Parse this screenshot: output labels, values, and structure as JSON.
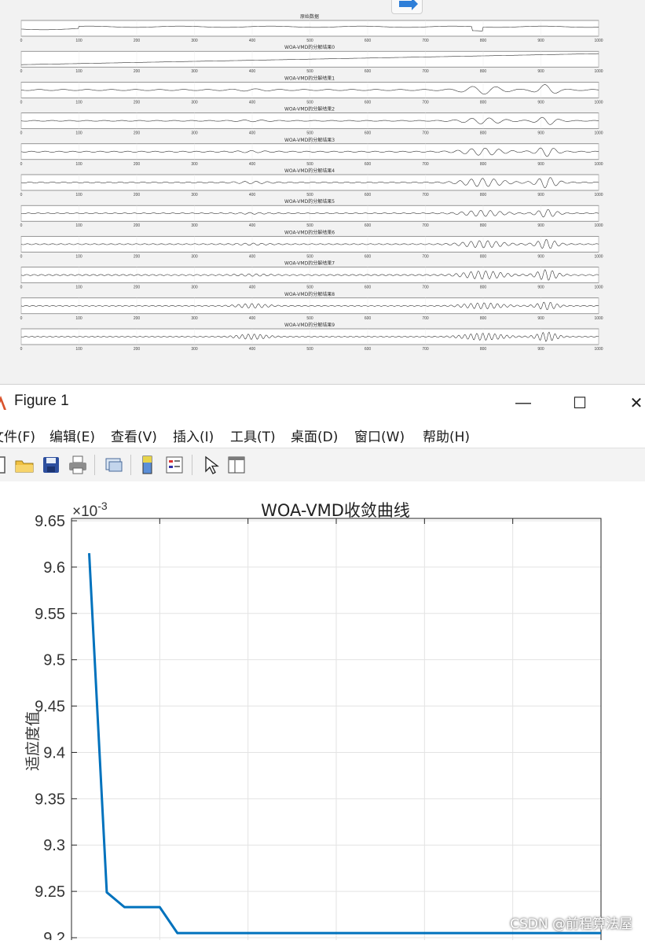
{
  "top_figure": {
    "panel_titles": [
      "原始数据",
      "WOA-VMD的分解结果0",
      "WOA-VMD的分解结果1",
      "WOA-VMD的分解结果2",
      "WOA-VMD的分解结果3",
      "WOA-VMD的分解结果4",
      "WOA-VMD的分解结果5",
      "WOA-VMD的分解结果6",
      "WOA-VMD的分解结果7",
      "WOA-VMD的分解结果8",
      "WOA-VMD的分解结果9"
    ],
    "x_ticks": [
      "0",
      "100",
      "200",
      "300",
      "400",
      "500",
      "600",
      "700",
      "800",
      "900",
      "1000"
    ],
    "xlim": [
      0,
      1000
    ]
  },
  "window": {
    "title": "Figure 1",
    "minimize_glyph": "—",
    "maximize_glyph": "☐",
    "close_glyph": "✕"
  },
  "menu": {
    "items": [
      "文件(F)",
      "编辑(E)",
      "查看(V)",
      "插入(I)",
      "工具(T)",
      "桌面(D)",
      "窗口(W)",
      "帮助(H)"
    ]
  },
  "toolbar": {
    "icons": [
      "new-figure-icon",
      "open-folder-icon",
      "save-icon",
      "print-icon",
      "link-plot-icon",
      "insert-colorbar-icon",
      "insert-legend-icon",
      "pointer-icon",
      "property-editor-icon"
    ]
  },
  "chart_data": {
    "type": "line",
    "title": "WOA-VMD收敛曲线",
    "ylabel": "适应度值",
    "xlabel": "",
    "exponent_label": "×10",
    "exponent_power": "-3",
    "y_tick_labels": [
      "9.2",
      "9.25",
      "9.3",
      "9.35",
      "9.4",
      "9.45",
      "9.5",
      "9.55",
      "9.6",
      "9.65"
    ],
    "y_ticks": [
      9.2,
      9.25,
      9.3,
      9.35,
      9.4,
      9.45,
      9.5,
      9.55,
      9.6,
      9.65
    ],
    "ylim": [
      9.2,
      9.65
    ],
    "xlim": [
      0,
      30
    ],
    "x_grid": [
      0,
      5,
      10,
      15,
      20,
      25,
      30
    ],
    "grid": true,
    "line_color": "#0072BD",
    "series": [
      {
        "x": [
          1,
          2,
          3,
          4,
          5,
          6,
          7,
          8,
          9,
          10,
          11,
          12,
          13,
          14,
          15,
          16,
          17,
          18,
          19,
          20,
          21,
          22,
          23,
          24,
          25,
          26,
          27,
          28,
          29,
          30
        ],
        "values": [
          9.615,
          9.249,
          9.233,
          9.233,
          9.233,
          9.205,
          9.205,
          9.205,
          9.205,
          9.205,
          9.205,
          9.205,
          9.205,
          9.205,
          9.205,
          9.205,
          9.205,
          9.205,
          9.205,
          9.205,
          9.205,
          9.205,
          9.205,
          9.205,
          9.205,
          9.205,
          9.205,
          9.205,
          9.205,
          9.205
        ]
      }
    ]
  },
  "watermark": "CSDN @前程算法屋"
}
